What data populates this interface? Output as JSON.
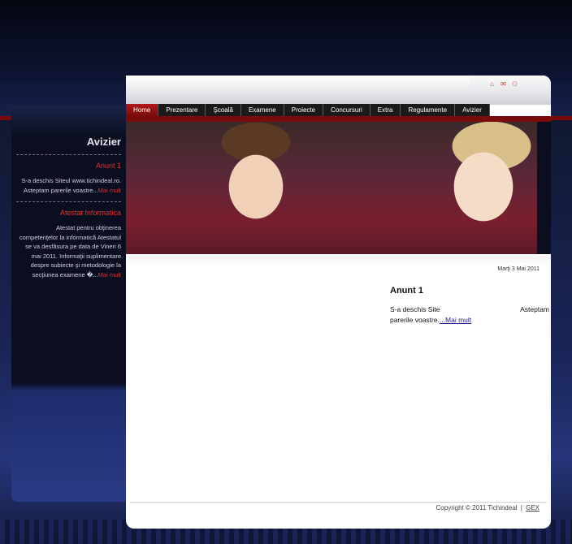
{
  "header": {
    "icons": [
      "home-icon",
      "mail-icon",
      "sitemap-icon"
    ]
  },
  "nav": {
    "items": [
      {
        "label": "Home",
        "active": true
      },
      {
        "label": "Prezentare",
        "active": false
      },
      {
        "label": "Şcoală",
        "active": false
      },
      {
        "label": "Examene",
        "active": false
      },
      {
        "label": "Proiecte",
        "active": false
      },
      {
        "label": "Concursuri",
        "active": false
      },
      {
        "label": "Extra",
        "active": false
      },
      {
        "label": "Regulamente",
        "active": false
      },
      {
        "label": "Avizier",
        "active": false
      }
    ]
  },
  "sidebar": {
    "title": "Avizier",
    "items": [
      {
        "title": "Anunt 1",
        "text": "S-a deschis Siteul www.tichindeal.ro. Asteptam parerile voastre...",
        "more": "Mai mult"
      },
      {
        "title": "Atestat Informatica",
        "text": "Atestat pentru obţinerea competenţelor la informatică Atestatul se va desfăsura pe data de Vineri 6 mai 2011. Informaţii suplimentare despre subiecte şi metodologie la secţiunea examene �...",
        "more": "Mai mult"
      }
    ]
  },
  "main": {
    "date": "Marţi 3 Mai 2011",
    "article": {
      "title": "Anunt 1",
      "text_before_gap": "S-a deschis Site",
      "text_after_gap": "Asteptam",
      "text_line2": "parerile voastre.",
      "more": "...Mai mult"
    }
  },
  "footer": {
    "copyright": "Copyright © 2011 Tichindeal",
    "separator": "|",
    "link": "GEX"
  },
  "colors": {
    "accent_red": "#7a0b0b",
    "link_red": "#e03030",
    "page_bg": "#0b1027"
  }
}
